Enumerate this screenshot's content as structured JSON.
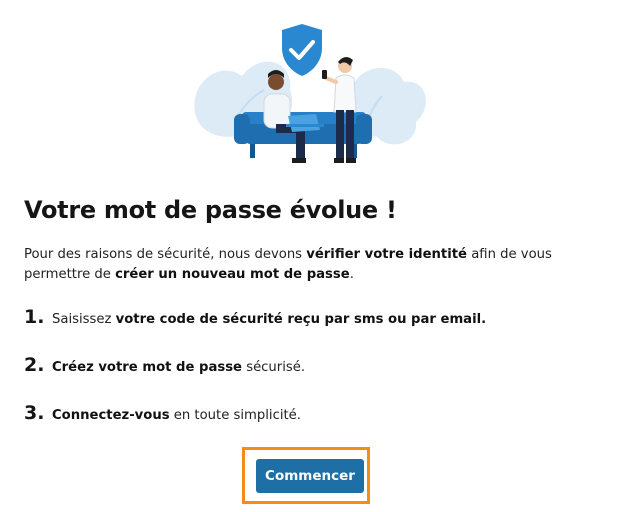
{
  "page": {
    "title": "Votre mot de passe évolue !",
    "intro": {
      "t1": "Pour des raisons de sécurité, nous devons ",
      "b1": "vérifier votre identité",
      "t2": " afin de vous permettre de ",
      "b2": "créer un nouveau mot de passe",
      "t3": "."
    },
    "steps": [
      {
        "num": "1.",
        "pre": "Saisissez ",
        "bold": "votre code de sécurité reçu par sms ou par email.",
        "post": ""
      },
      {
        "num": "2.",
        "pre": "",
        "bold": "Créez votre mot de passe",
        "post": " sécurisé."
      },
      {
        "num": "3.",
        "pre": "",
        "bold": "Connectez-vous",
        "post": " en toute simplicité."
      }
    ],
    "cta_label": "Commencer"
  },
  "colors": {
    "accent": "#1d6fa5",
    "highlight": "#f28c1a",
    "illustration_light": "#dcebf6",
    "illustration_blue": "#2a88d0",
    "sofa": "#1e6eb0",
    "navy": "#1c2b4a"
  },
  "icons": {
    "hero": "security-illustration",
    "shield": "shield-check-icon"
  }
}
